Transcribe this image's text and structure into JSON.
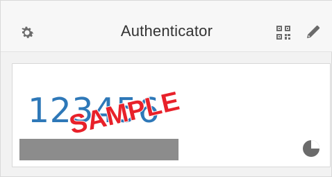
{
  "header": {
    "title": "Authenticator",
    "icons": {
      "settings": "gear-icon",
      "scan": "qr-code-icon",
      "edit": "pencil-icon"
    }
  },
  "account": {
    "code": "123456",
    "issuer_redacted": true,
    "timer_icon": "countdown-pie-icon",
    "timer_remaining_fraction": 0.75
  },
  "overlay": {
    "watermark": "SAMPLE"
  },
  "colors": {
    "code": "#2e78b8",
    "icon": "#6b6b6b",
    "watermark": "#e8212a",
    "redaction": "#8c8c8c"
  }
}
